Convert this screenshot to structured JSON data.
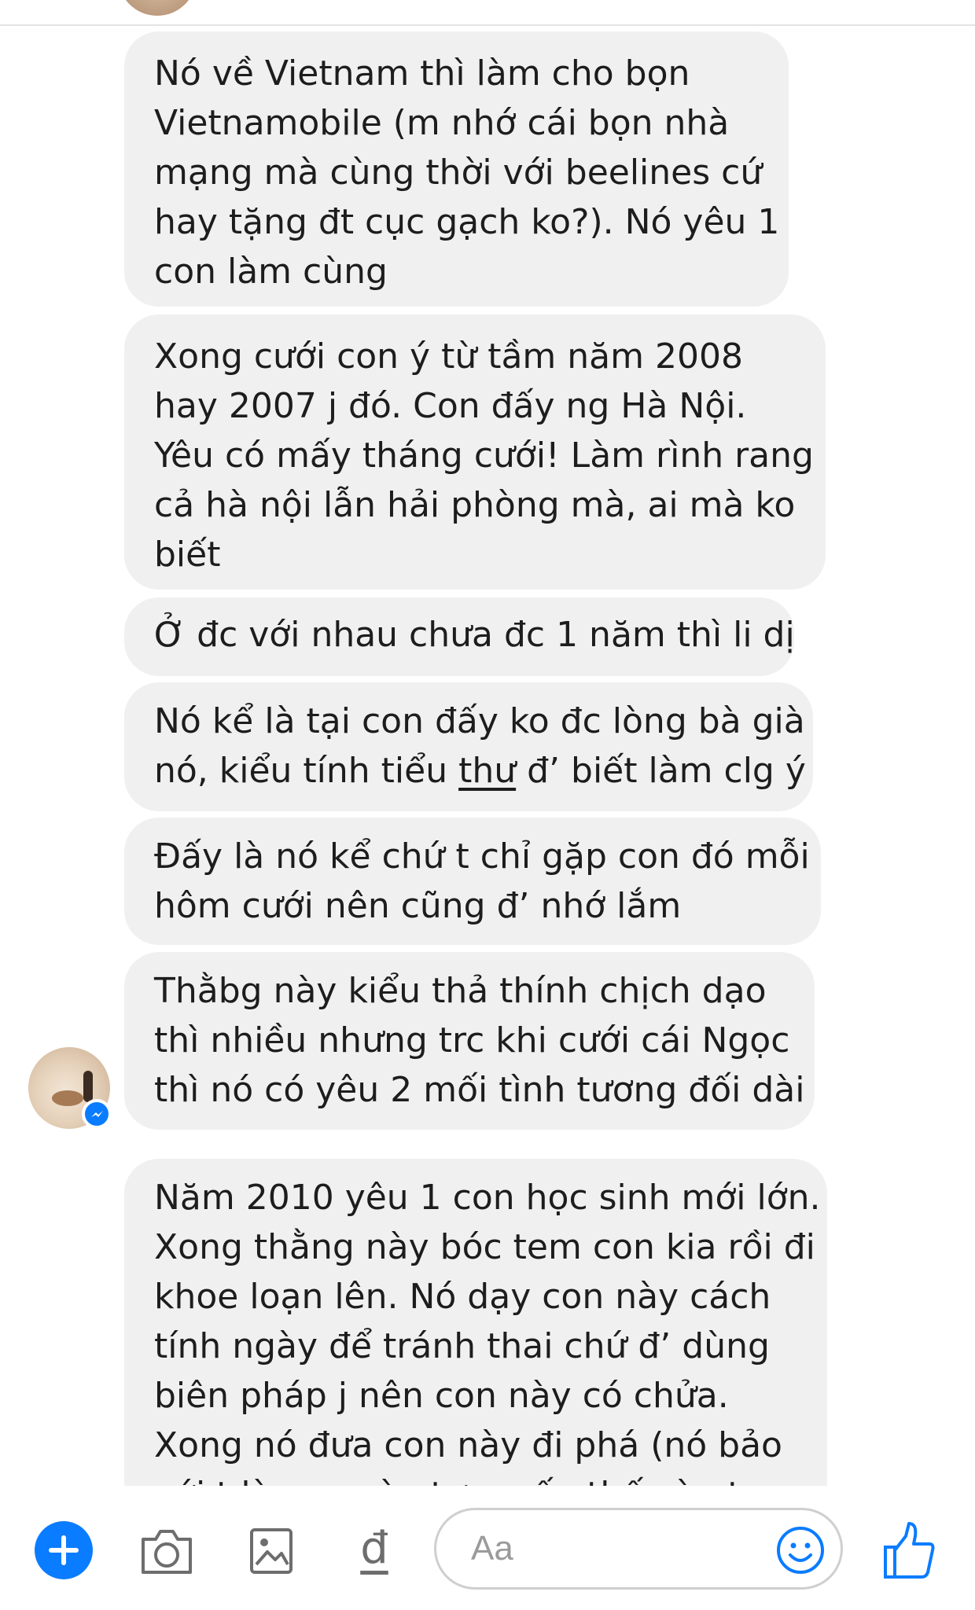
{
  "messages": [
    {
      "lines": "Nó về Vietnam thì làm cho bọn\nVietnamobile (m nhớ cái bọn nhà\nmạng mà cùng thời với beelines cứ\nhay tặng đt cục gạch ko?). Nó yêu 1\ncon làm cùng"
    },
    {
      "lines": "Xong cưới con ý từ tầm năm 2008\nhay 2007 j đó. Con đấy ng Hà Nội.\nYêu có mấy tháng cưới! Làm rình rang\ncả hà nội lẫn hải phòng mà, ai mà ko\nbiết"
    },
    {
      "lines": "Ở đc với nhau chưa đc 1 năm thì li dị"
    },
    {
      "line1": "Nó kể là tại con đấy ko đc lòng bà già",
      "line2_pre": "nó, kiểu tính tiểu ",
      "line2_underlined": "thư",
      "line2_post": " đ’ biết làm clg ý"
    },
    {
      "lines": "Đấy là nó kể chứ t chỉ gặp con đó mỗi\nhôm cưới nên cũng đ’ nhớ lắm"
    },
    {
      "lines": "Thằbg này kiểu thả thính chịch dạo\nthì nhiều nhưng trc khi cưới cái Ngọc\nthì nó có yêu 2 mối tình tương đối dài"
    },
    {
      "lines": "Năm 2010 yêu 1 con học sinh mới lớn.\nXong thằng này bóc tem con kia rồi đi\nkhoe loạn lên. Nó dạy con này cách\ntính ngày để tránh thai chứ đ’ dùng\nbiên pháp j nên con này có chửa.\nXong nó đưa con này đi phá (nó bảo\nvới t là con này tự muốn thế còn t"
    }
  ],
  "composer": {
    "placeholder": "Aa",
    "dong_glyph": "đ",
    "icons": [
      "plus-icon",
      "camera-icon",
      "image-icon",
      "dong-icon",
      "emoji-icon",
      "thumbs-up-icon"
    ],
    "accent": "#0a7cff"
  }
}
